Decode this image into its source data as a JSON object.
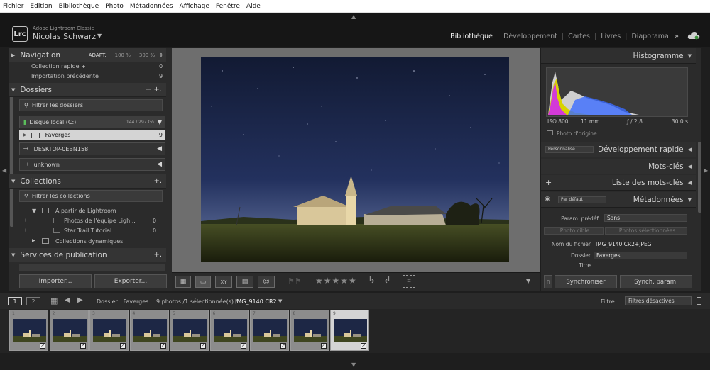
{
  "menu": [
    "Fichier",
    "Edition",
    "Bibliothèque",
    "Photo",
    "Métadonnées",
    "Affichage",
    "Fenêtre",
    "Aide"
  ],
  "identity": {
    "logo": "Lrc",
    "app_name": "Adobe Lightroom Classic",
    "user": "Nicolas Schwarz"
  },
  "modules": [
    {
      "label": "Bibliothèque",
      "active": true
    },
    {
      "label": "Développement",
      "active": false
    },
    {
      "label": "Cartes",
      "active": false
    },
    {
      "label": "Livres",
      "active": false
    },
    {
      "label": "Diaporama",
      "active": false
    }
  ],
  "left": {
    "navigation": {
      "title": "Navigation",
      "zoom_fit": "ADAPT.",
      "zoom_100": "100 %",
      "zoom_300": "300 %"
    },
    "catalog": [
      {
        "label": "Collection rapide +",
        "count": "0"
      },
      {
        "label": "Importation précédente",
        "count": "9"
      }
    ],
    "folders": {
      "title": "Dossiers",
      "actions": "− +.",
      "filter_placeholder": "Filtrer les dossiers",
      "disk": {
        "label": "Disque local (C:)",
        "size": "144 / 297 Go"
      },
      "folder": {
        "label": "Faverges",
        "count": "9"
      },
      "remote1": "DESKTOP-0EBN158",
      "remote2": "unknown"
    },
    "collections": {
      "title": "Collections",
      "action": "+.",
      "filter_placeholder": "Filtrer les collections",
      "items": [
        {
          "label": "A partir de Lightroom",
          "count": ""
        },
        {
          "label": "Photos de l'équipe Ligh...",
          "count": "0"
        },
        {
          "label": "Star Trail Tutorial",
          "count": "0"
        },
        {
          "label": "Collections dynamiques",
          "count": ""
        }
      ]
    },
    "publish": {
      "title": "Services de publication",
      "action": "+."
    },
    "import_label": "Importer...",
    "export_label": "Exporter..."
  },
  "right": {
    "histogram": {
      "title": "Histogramme",
      "iso": "ISO 800",
      "focal": "11 mm",
      "aperture": "ƒ / 2,8",
      "shutter": "30,0 s",
      "original": "Photo d'origine"
    },
    "quick_develop": {
      "preset": "Personnalisé",
      "title": "Développement rapide"
    },
    "keywords": {
      "title": "Mots-clés"
    },
    "keyword_list": {
      "title": "Liste des mots-clés"
    },
    "metadata": {
      "preset": "Par défaut",
      "title": "Métadonnées",
      "preset_label": "Param. prédéf",
      "preset_value": "Sans",
      "tab_target": "Photo cible",
      "tab_selected": "Photos sélectionnées",
      "filename_label": "Nom du fichier",
      "filename": "IMG_9140.CR2+JPEG",
      "folder_label": "Dossier",
      "folder": "Faverges",
      "title_label": "Titre"
    },
    "sync_label": "Synchroniser",
    "sync_params_label": "Synch. param."
  },
  "filmstrip": {
    "screen1": "1",
    "screen2": "2",
    "source": "Dossier : Faverges",
    "count": "9 photos /1 sélectionnée(s) /",
    "file": "IMG_9140.CR2",
    "filter_label": "Filtre :",
    "filter_value": "Filtres désactivés",
    "thumbs": [
      "1",
      "2",
      "3",
      "4",
      "5",
      "6",
      "7",
      "8",
      "9"
    ],
    "selected_index": 8
  },
  "colors": {
    "panel": "#2b2b2b",
    "center": "#6e6e6e",
    "sky": "#1b2440",
    "accent": "#f2f2f2"
  }
}
